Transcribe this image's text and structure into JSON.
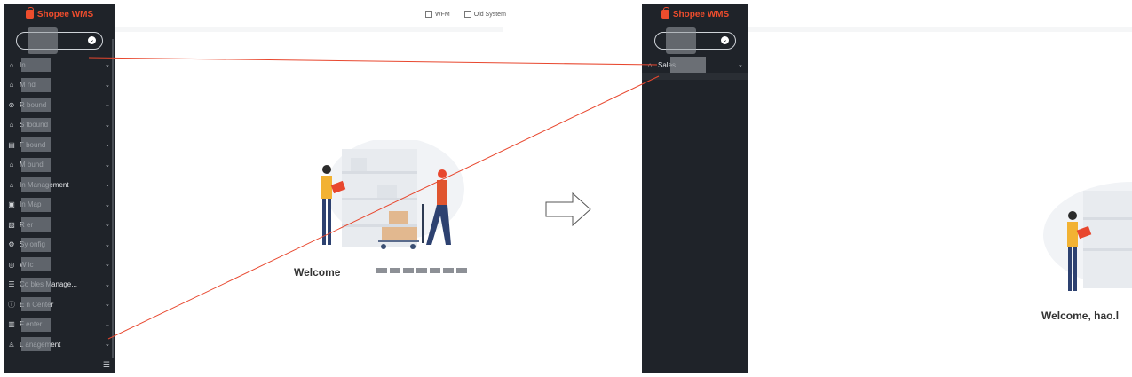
{
  "brand": {
    "logo_text": "Shopee WMS",
    "accent": "#ee4d2d",
    "sidebar_bg": "#1f2329"
  },
  "left_sidebar": {
    "items": [
      {
        "icon": "home-icon",
        "label": "In"
      },
      {
        "icon": "home-icon",
        "label": "M          nd"
      },
      {
        "icon": "return-icon",
        "label": "R          bound"
      },
      {
        "icon": "home-icon",
        "label": "S          tbound"
      },
      {
        "icon": "table-icon",
        "label": "F          bound"
      },
      {
        "icon": "home-icon",
        "label": "M          bund"
      },
      {
        "icon": "warehouse-icon",
        "label": "In          Management"
      },
      {
        "icon": "map-icon",
        "label": "In          Map"
      },
      {
        "icon": "report-icon",
        "label": "R          er"
      },
      {
        "icon": "gear-icon",
        "label": "Sy          onfig"
      },
      {
        "icon": "clock-icon",
        "label": "W          ic"
      },
      {
        "icon": "list-icon",
        "label": "Co          bles Manage..."
      },
      {
        "icon": "info-icon",
        "label": "E          n Center"
      },
      {
        "icon": "store-icon",
        "label": "F          enter"
      },
      {
        "icon": "user-icon",
        "label": "L          anagement"
      }
    ]
  },
  "right_sidebar": {
    "items": [
      {
        "icon": "home-icon",
        "label": "Sales"
      }
    ]
  },
  "topbar": {
    "wfm_label": "WFM",
    "old_system_label": "Old System"
  },
  "welcome": {
    "left_text": "Welcome",
    "right_text": "Welcome, hao.l"
  },
  "colors": {
    "annotation_line": "#e8472e"
  }
}
